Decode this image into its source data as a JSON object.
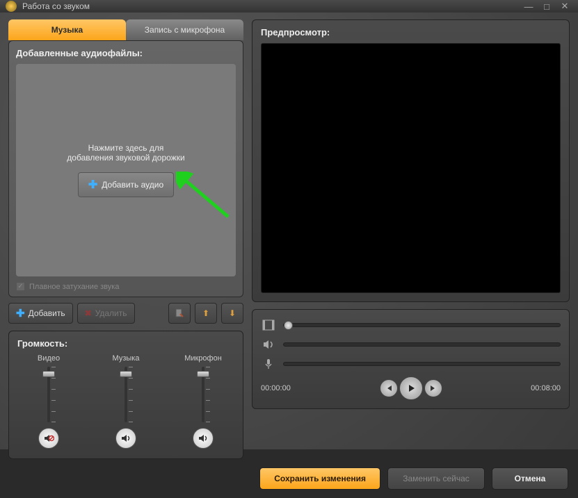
{
  "window": {
    "title": "Работа со звуком"
  },
  "tabs": {
    "music": "Музыка",
    "mic": "Запись с микрофона"
  },
  "files": {
    "title": "Добавленные аудиофайлы:",
    "hint": "Нажмите здесь для\nдобавления звуковой дорожки",
    "add_audio": "Добавить аудио",
    "fade_label": "Плавное затухание звука",
    "add": "Добавить",
    "delete": "Удалить"
  },
  "volume": {
    "title": "Громкость:",
    "video": "Видео",
    "music": "Музыка",
    "mic": "Микрофон"
  },
  "preview": {
    "title": "Предпросмотр:"
  },
  "transport": {
    "current": "00:00:00",
    "total": "00:08:00"
  },
  "buttons": {
    "save": "Сохранить изменения",
    "replace": "Заменить сейчас",
    "cancel": "Отмена"
  }
}
